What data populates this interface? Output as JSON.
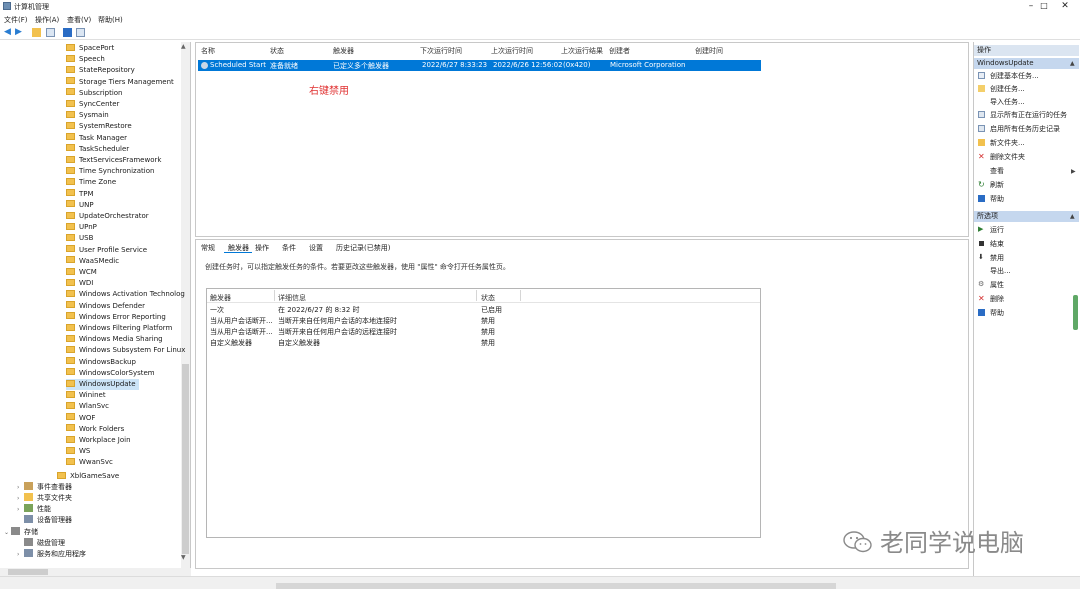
{
  "window": {
    "title": "计算机管理"
  },
  "menu": [
    "文件(F)",
    "操作(A)",
    "查看(V)",
    "帮助(H)"
  ],
  "tree": {
    "items": [
      {
        "label": "SpacePort"
      },
      {
        "label": "Speech"
      },
      {
        "label": "StateRepository"
      },
      {
        "label": "Storage Tiers Management"
      },
      {
        "label": "Subscription"
      },
      {
        "label": "SyncCenter"
      },
      {
        "label": "Sysmain"
      },
      {
        "label": "SystemRestore"
      },
      {
        "label": "Task Manager"
      },
      {
        "label": "TaskScheduler"
      },
      {
        "label": "TextServicesFramework"
      },
      {
        "label": "Time Synchronization"
      },
      {
        "label": "Time Zone"
      },
      {
        "label": "TPM"
      },
      {
        "label": "UNP"
      },
      {
        "label": "UpdateOrchestrator"
      },
      {
        "label": "UPnP"
      },
      {
        "label": "USB"
      },
      {
        "label": "User Profile Service"
      },
      {
        "label": "WaaSMedic"
      },
      {
        "label": "WCM"
      },
      {
        "label": "WDI"
      },
      {
        "label": "Windows Activation Technolog"
      },
      {
        "label": "Windows Defender"
      },
      {
        "label": "Windows Error Reporting"
      },
      {
        "label": "Windows Filtering Platform"
      },
      {
        "label": "Windows Media Sharing"
      },
      {
        "label": "Windows Subsystem For Linux"
      },
      {
        "label": "WindowsBackup"
      },
      {
        "label": "WindowsColorSystem"
      },
      {
        "label": "WindowsUpdate"
      },
      {
        "label": "Wininet"
      },
      {
        "label": "WlanSvc"
      },
      {
        "label": "WOF"
      },
      {
        "label": "Work Folders"
      },
      {
        "label": "Workplace Join"
      },
      {
        "label": "WS"
      },
      {
        "label": "WwanSvc"
      }
    ],
    "xbl": "XblGameSave",
    "lower": [
      {
        "label": "事件查看器"
      },
      {
        "label": "共享文件夹"
      },
      {
        "label": "性能"
      },
      {
        "label": "设备管理器"
      },
      {
        "label": "存储"
      },
      {
        "label": "磁盘管理"
      },
      {
        "label": "服务和应用程序"
      }
    ]
  },
  "tasks": {
    "columns": [
      "名称",
      "状态",
      "触发器",
      "下次运行时间",
      "上次运行时间",
      "上次运行结果",
      "创建者",
      "创建时间"
    ],
    "row": {
      "name": "Scheduled Start",
      "status": "准备就绪",
      "trigger": "已定义多个触发器",
      "next_run": "2022/6/27 8:33:23",
      "last_run": "2022/6/26 12:56:02",
      "last_result": "(0x420)",
      "author": "Microsoft Corporation"
    },
    "annotation": "右键禁用"
  },
  "detail": {
    "tabs": [
      "常规",
      "触发器",
      "操作",
      "条件",
      "设置",
      "历史记录(已禁用)"
    ],
    "active_tab": "触发器",
    "description": "创建任务时，可以指定触发任务的条件。若要更改这些触发器，使用 \"属性\" 命令打开任务属性页。",
    "table": {
      "headers": [
        "触发器",
        "详细信息",
        "状态"
      ],
      "rows": [
        {
          "trigger": "一次",
          "details": "在 2022/6/27 的 8:32 时",
          "status": "已启用"
        },
        {
          "trigger": "当从用户会话断开...",
          "details": "当断开来自任何用户会话的本地连接时",
          "status": "禁用"
        },
        {
          "trigger": "当从用户会话断开...",
          "details": "当断开来自任何用户会话的远程连接时",
          "status": "禁用"
        },
        {
          "trigger": "自定义触发器",
          "details": "自定义触发器",
          "status": "禁用"
        }
      ]
    }
  },
  "actions": {
    "header": "操作",
    "section1": "WindowsUpdate",
    "section1_items": [
      "创建基本任务...",
      "创建任务...",
      "导入任务...",
      "显示所有正在运行的任务",
      "启用所有任务历史记录",
      "新文件夹...",
      "删除文件夹",
      "查看",
      "刷新",
      "帮助"
    ],
    "section2": "所选项",
    "section2_items": [
      "运行",
      "结束",
      "禁用",
      "导出...",
      "属性",
      "删除",
      "帮助"
    ]
  },
  "watermark": "老同学说电脑",
  "colors": {
    "selection": "#0078d7",
    "annotation": "#e03131",
    "folder": "#f2c14e"
  }
}
